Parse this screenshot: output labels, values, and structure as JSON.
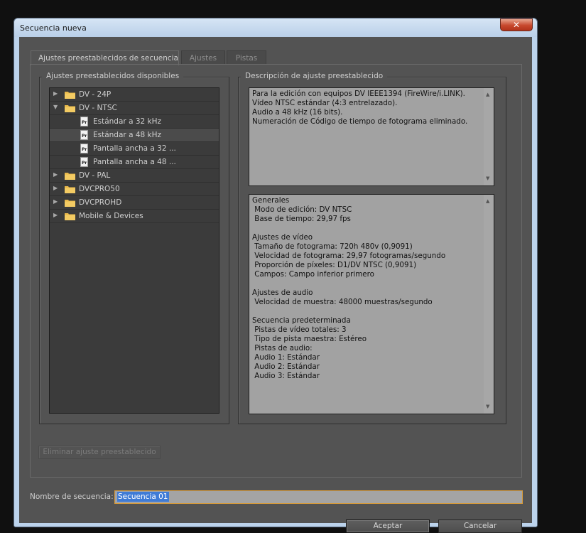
{
  "window": {
    "title": "Secuencia nueva",
    "close_glyph": "✕"
  },
  "tabs": [
    {
      "label": "Ajustes preestablecidos de secuencia",
      "active": true
    },
    {
      "label": "Ajustes",
      "active": false
    },
    {
      "label": "Pistas",
      "active": false
    }
  ],
  "presets_panel": {
    "title": "Ajustes preestablecidos disponibles",
    "items": [
      {
        "label": "DV - 24P",
        "type": "folder",
        "expanded": false
      },
      {
        "label": "DV - NTSC",
        "type": "folder",
        "expanded": true
      },
      {
        "label": "Estándar a 32 kHz",
        "type": "preset",
        "icon_text": "Pr"
      },
      {
        "label": "Estándar a 48 kHz",
        "type": "preset",
        "icon_text": "Pr",
        "selected": true
      },
      {
        "label": "Pantalla ancha a 32 ...",
        "type": "preset",
        "icon_text": "Pr"
      },
      {
        "label": "Pantalla ancha a 48 ...",
        "type": "preset",
        "icon_text": "Pr"
      },
      {
        "label": "DV - PAL",
        "type": "folder",
        "expanded": false
      },
      {
        "label": "DVCPRO50",
        "type": "folder",
        "expanded": false
      },
      {
        "label": "DVCPROHD",
        "type": "folder",
        "expanded": false
      },
      {
        "label": "Mobile & Devices",
        "type": "folder",
        "expanded": false
      }
    ]
  },
  "description_panel": {
    "title": "Descripción de ajuste preestablecido",
    "summary": "Para la edición con equipos DV IEEE1394 (FireWire/i.LINK).\nVídeo NTSC estándar (4:3 entrelazado).\nAudio a 48 kHz (16 bits).\nNumeración de Código de tiempo de fotograma eliminado.",
    "details": "Generales\n Modo de edición: DV NTSC\n Base de tiempo: 29,97 fps\n\nAjustes de vídeo\n Tamaño de fotograma: 720h 480v (0,9091)\n Velocidad de fotograma: 29,97 fotogramas/segundo\n Proporción de píxeles: D1/DV NTSC (0,9091)\n Campos: Campo inferior primero\n\nAjustes de audio\n Velocidad de muestra: 48000 muestras/segundo\n\nSecuencia predeterminada\n Pistas de vídeo totales: 3\n Tipo de pista maestra: Estéreo\n Pistas de audio:\n Audio 1: Estándar\n Audio 2: Estándar\n Audio 3: Estándar"
  },
  "delete_button": {
    "label": "Eliminar ajuste preestablecido",
    "enabled": false
  },
  "sequence_name": {
    "label": "Nombre de secuencia:",
    "value": "Secuencia 01"
  },
  "buttons": {
    "ok": "Aceptar",
    "cancel": "Cancelar"
  },
  "colors": {
    "background": "#535353",
    "tree_bg": "#3b3b3b",
    "desc_bg": "#a2a2a2",
    "folder": "#e8b84a",
    "input_border": "#d79b3b",
    "selection": "#3f7bd6"
  }
}
